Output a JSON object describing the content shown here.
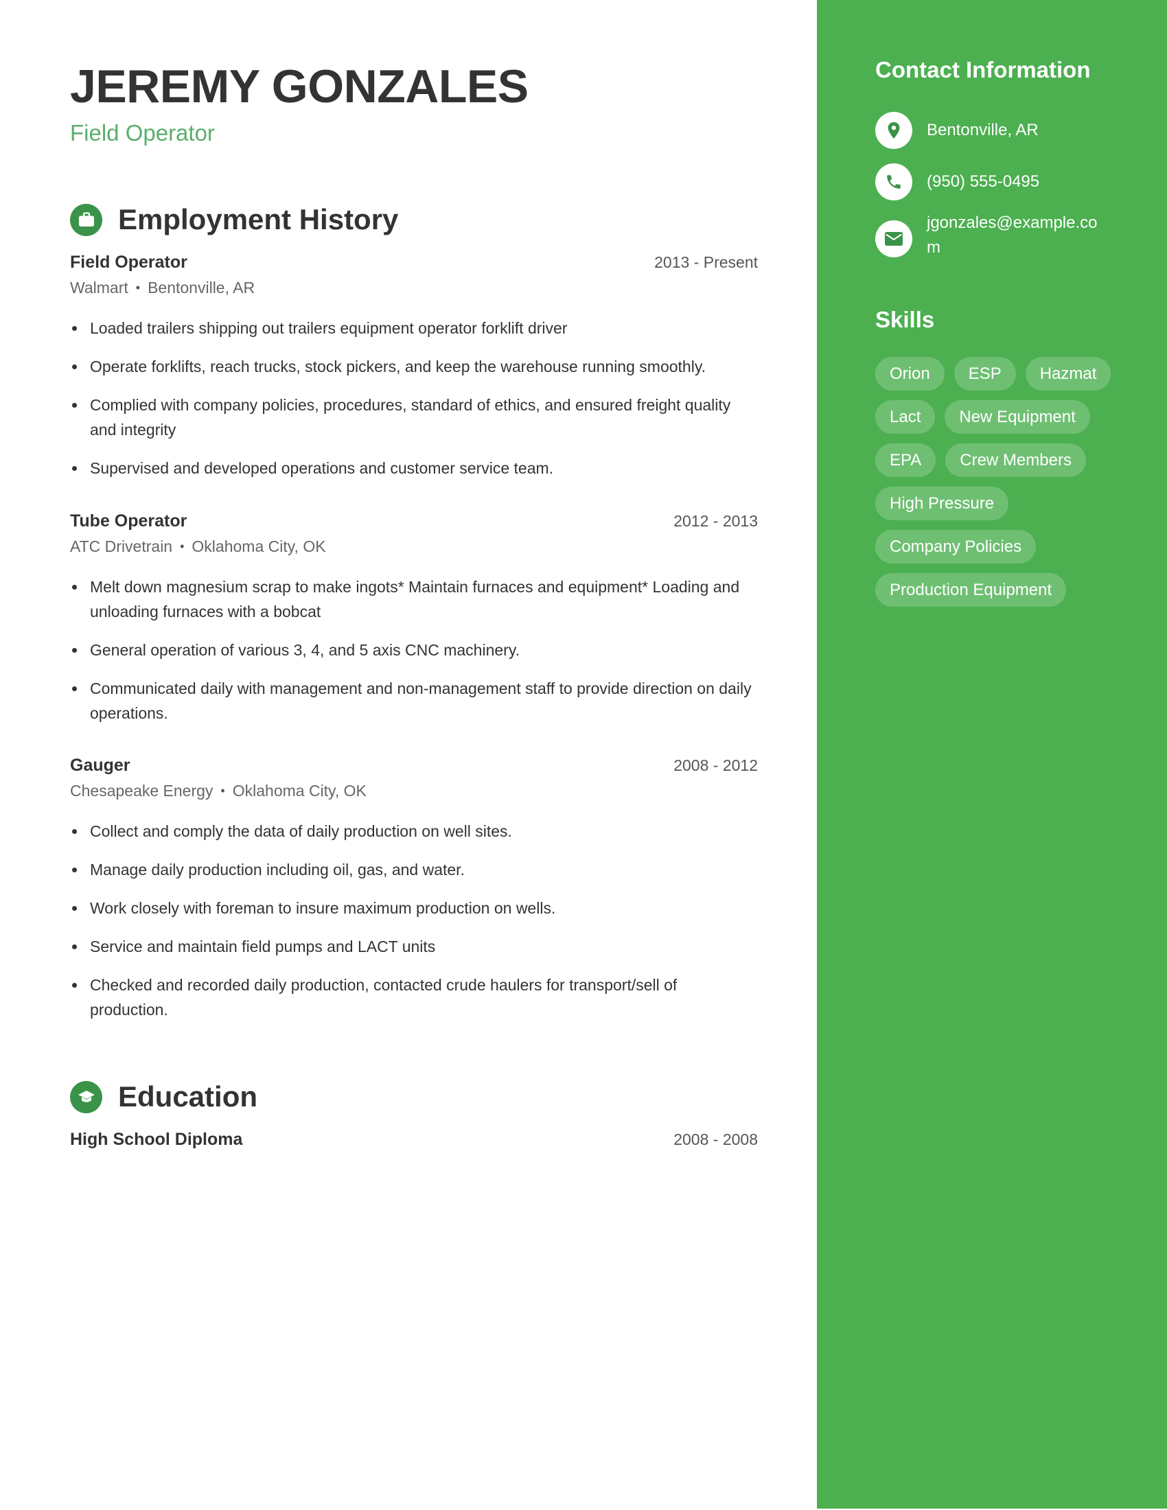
{
  "header": {
    "name": "JEREMY GONZALES",
    "title": "Field Operator"
  },
  "colors": {
    "accent_sidebar": "#4caf50",
    "accent_icon": "#3a9348",
    "subtitle": "#5aae6d"
  },
  "employment": {
    "heading": "Employment History",
    "icon": "briefcase-icon",
    "jobs": [
      {
        "title": "Field Operator",
        "dates": "2013 - Present",
        "company": "Walmart",
        "location": "Bentonville, AR",
        "bullets": [
          "Loaded trailers shipping out trailers equipment operator forklift driver",
          "Operate forklifts, reach trucks, stock pickers, and keep the warehouse running smoothly.",
          "Complied with company policies, procedures, standard of ethics, and ensured freight quality and integrity",
          "Supervised and developed operations and customer service team."
        ]
      },
      {
        "title": "Tube Operator",
        "dates": "2012 - 2013",
        "company": "ATC Drivetrain",
        "location": "Oklahoma City, OK",
        "bullets": [
          "Melt down magnesium scrap to make ingots* Maintain furnaces and equipment* Loading and unloading furnaces with a bobcat",
          "General operation of various 3, 4, and 5 axis CNC machinery.",
          "Communicated daily with management and non-management staff to provide direction on daily operations."
        ]
      },
      {
        "title": "Gauger",
        "dates": "2008 - 2012",
        "company": "Chesapeake Energy",
        "location": "Oklahoma City, OK",
        "bullets": [
          "Collect and comply the data of daily production on well sites.",
          "Manage daily production including oil, gas, and water.",
          "Work closely with foreman to insure maximum production on wells.",
          "Service and maintain field pumps and LACT units",
          "Checked and recorded daily production, contacted crude haulers for transport/sell of production."
        ]
      }
    ],
    "separator": "•"
  },
  "education": {
    "heading": "Education",
    "icon": "graduation-cap-icon",
    "items": [
      {
        "degree": "High School Diploma",
        "dates": "2008 - 2008"
      }
    ]
  },
  "sidebar": {
    "contact_heading": "Contact Information",
    "contacts": [
      {
        "icon": "location-pin-icon",
        "text": "Bentonville, AR"
      },
      {
        "icon": "phone-icon",
        "text": "(950) 555-0495"
      },
      {
        "icon": "email-icon",
        "text": "jgonzales@example.com"
      }
    ],
    "skills_heading": "Skills",
    "skills": [
      "Orion",
      "ESP",
      "Hazmat",
      "Lact",
      "New Equipment",
      "EPA",
      "Crew Members",
      "High Pressure",
      "Company Policies",
      "Production Equipment"
    ]
  }
}
